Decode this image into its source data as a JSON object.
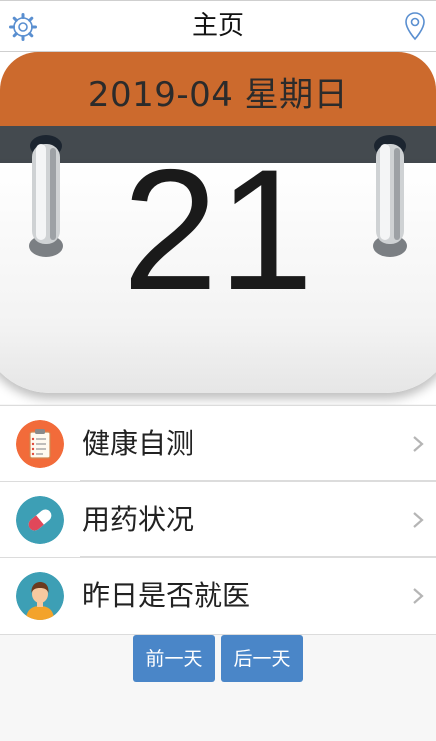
{
  "header": {
    "title": "主页",
    "left_icon": "gear-icon",
    "right_icon": "location-pin-icon"
  },
  "calendar": {
    "month_label": "2019-04 星期日",
    "day": "21",
    "header_color": "#cc6a2d"
  },
  "menu": {
    "items": [
      {
        "label": "健康自测",
        "icon": "clipboard-icon",
        "icon_bg": "#f26b3a"
      },
      {
        "label": "用药状况",
        "icon": "pill-icon",
        "icon_bg": "#3d9fb5"
      },
      {
        "label": "昨日是否就医",
        "icon": "doctor-avatar-icon",
        "icon_bg": "#3d9fb5"
      }
    ]
  },
  "buttons": {
    "prev_label": "前一天",
    "next_label": "后一天",
    "color": "#4a86c8"
  }
}
